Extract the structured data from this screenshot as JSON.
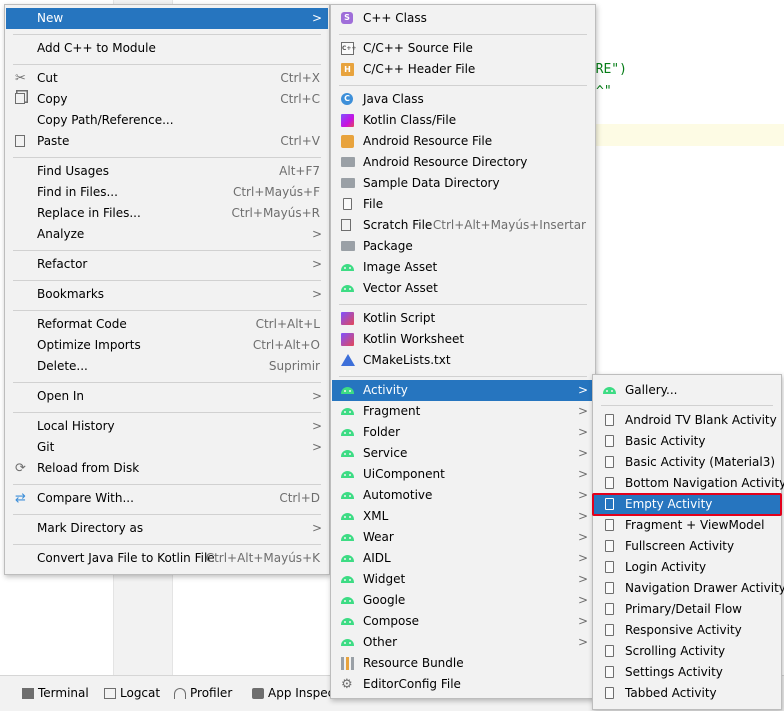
{
  "background": {
    "code_line1": "...",
    "code_line2": "MBRE\")",
    "code_line3": "^\""
  },
  "bottom_bar": {
    "tabs": [
      "Terminal",
      "Logcat",
      "Profiler",
      "App Inspect"
    ]
  },
  "context_menu": {
    "new": "New",
    "add_cpp": "Add C++ to Module",
    "cut": "Cut",
    "cut_sc": "Ctrl+X",
    "copy": "Copy",
    "copy_sc": "Ctrl+C",
    "copy_path": "Copy Path/Reference...",
    "paste": "Paste",
    "paste_sc": "Ctrl+V",
    "find_usages": "Find Usages",
    "find_usages_sc": "Alt+F7",
    "find_in_files": "Find in Files...",
    "find_in_files_sc": "Ctrl+Mayús+F",
    "replace_in_files": "Replace in Files...",
    "replace_in_files_sc": "Ctrl+Mayús+R",
    "analyze": "Analyze",
    "refactor": "Refactor",
    "bookmarks": "Bookmarks",
    "reformat": "Reformat Code",
    "reformat_sc": "Ctrl+Alt+L",
    "optimize": "Optimize Imports",
    "optimize_sc": "Ctrl+Alt+O",
    "delete": "Delete...",
    "delete_sc": "Suprimir",
    "open_in": "Open In",
    "local_history": "Local History",
    "git": "Git",
    "reload": "Reload from Disk",
    "compare": "Compare With...",
    "compare_sc": "Ctrl+D",
    "mark_dir": "Mark Directory as",
    "convert": "Convert Java File to Kotlin File",
    "convert_sc": "Ctrl+Alt+Mayús+K"
  },
  "new_menu": {
    "cpp_class": "C++ Class",
    "cpp_source": "C/C++ Source File",
    "cpp_header": "C/C++ Header File",
    "java_class": "Java Class",
    "kotlin_class": "Kotlin Class/File",
    "android_res_file": "Android Resource File",
    "android_res_dir": "Android Resource Directory",
    "sample_data_dir": "Sample Data Directory",
    "file": "File",
    "scratch": "Scratch File",
    "scratch_sc": "Ctrl+Alt+Mayús+Insertar",
    "package": "Package",
    "image_asset": "Image Asset",
    "vector_asset": "Vector Asset",
    "kotlin_script": "Kotlin Script",
    "kotlin_worksheet": "Kotlin Worksheet",
    "cmake": "CMakeLists.txt",
    "activity": "Activity",
    "fragment": "Fragment",
    "folder": "Folder",
    "service": "Service",
    "uicomponent": "UiComponent",
    "automotive": "Automotive",
    "xml": "XML",
    "wear": "Wear",
    "aidl": "AIDL",
    "widget": "Widget",
    "google": "Google",
    "compose": "Compose",
    "other": "Other",
    "resource_bundle": "Resource Bundle",
    "editorconfig": "EditorConfig File"
  },
  "activity_menu": {
    "gallery": "Gallery...",
    "items": [
      "Android TV Blank Activity",
      "Basic Activity",
      "Basic Activity (Material3)",
      "Bottom Navigation Activity",
      "Empty Activity",
      "Fragment + ViewModel",
      "Fullscreen Activity",
      "Login Activity",
      "Navigation Drawer Activity",
      "Primary/Detail Flow",
      "Responsive Activity",
      "Scrolling Activity",
      "Settings Activity",
      "Tabbed Activity"
    ]
  },
  "colors": {
    "selection": "#2675bf",
    "highlight_outline": "#e3001b",
    "menu_bg": "#f2f2f2",
    "android_green": "#3ddc84"
  }
}
